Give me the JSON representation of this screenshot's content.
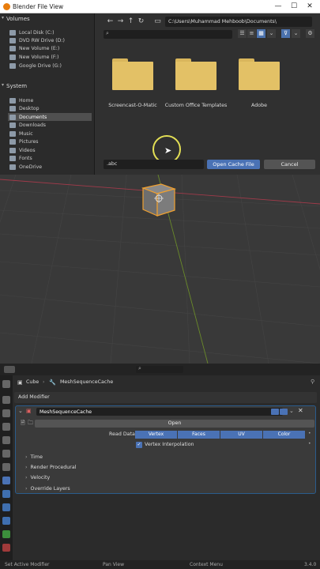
{
  "window": {
    "title": "Blender File View"
  },
  "sidebar": {
    "volumes_header": "Volumes",
    "volumes": [
      "Local Disk (C:)",
      "DVD RW Drive (D:)",
      "New Volume (E:)",
      "New Volume (F:)",
      "Google Drive (G:)"
    ],
    "system_header": "System",
    "system": [
      "Home",
      "Desktop",
      "Documents",
      "Downloads",
      "Music",
      "Pictures",
      "Videos",
      "Fonts",
      "OneDrive"
    ],
    "selected": "Documents"
  },
  "browser": {
    "path": "C:\\Users\\Muhammad Mehboob\\Documents\\",
    "folders": [
      "Screencast-O-Matic",
      "Custom Office Templates",
      "Adobe"
    ],
    "filename": ".abc",
    "open_label": "Open Cache File",
    "cancel_label": "Cancel"
  },
  "properties": {
    "object_name": "Cube",
    "modifier_crumb": "MeshSequenceCache",
    "add_modifier": "Add Modifier",
    "modifier_name": "MeshSequenceCache",
    "open_label": "Open",
    "read_data_label": "Read Data",
    "read_data_options": [
      "Vertex",
      "Faces",
      "UV",
      "Color"
    ],
    "vertex_interp": "Vertex Interpolation",
    "subpanels": [
      "Time",
      "Render Procedural",
      "Velocity",
      "Override Layers"
    ]
  },
  "statusbar": {
    "left": "Set Active Modifier",
    "mid": "Pan View",
    "right": "Context Menu",
    "version": "3.4.0"
  }
}
